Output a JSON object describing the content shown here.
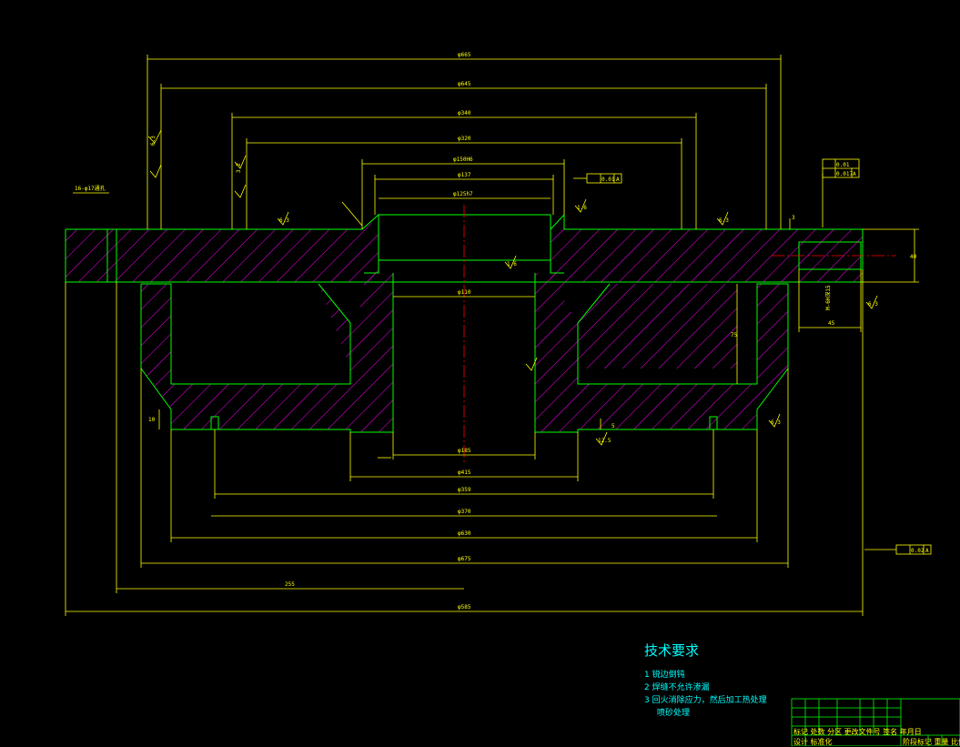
{
  "dims": {
    "d665": "φ665",
    "d645": "φ645",
    "d340": "φ340",
    "d320": "φ320",
    "d150": "φ150H6",
    "d137": "φ137",
    "d125": "φ125h7",
    "d110": "φ110",
    "d185": "φ185",
    "d415": "φ415",
    "d359": "φ359",
    "d370": "φ370",
    "d630": "φ630",
    "d675": "φ675",
    "d585": "φ585",
    "len255": "255",
    "holes": "16-φ17通孔",
    "thread": "M-6H深15",
    "dim45": "45",
    "dim3": "3",
    "dim40": "40",
    "dim75": "75",
    "dim10": "10",
    "dim5": "5"
  },
  "tolerances": {
    "runout1": "0.01",
    "runout2": "0.02",
    "flatness": "0.01",
    "perp": "0.017",
    "datum": "A"
  },
  "roughness": {
    "r1": "6.3",
    "r2": "3.2",
    "r3": "1.6",
    "r4": "12.5"
  },
  "tech": {
    "title": "技术要求",
    "items": [
      {
        "num": "1",
        "text": "锐边倒钝"
      },
      {
        "num": "2",
        "text": "焊缝不允许渗漏"
      },
      {
        "num": "3",
        "text": "回火消除应力，然后加工热处理"
      },
      {
        "num": "",
        "text": "喷砂处理"
      }
    ]
  },
  "titleblock": {
    "row1": "标记 处数 分区 更改文件号 签名 年月日",
    "row2": "设计 标准化",
    "row3": "阶段标记 重量 比例"
  },
  "colors": {
    "outline": "#00ff00",
    "dimension": "#ffff00",
    "hatch": "#ff00ff",
    "centerline": "#ff0000",
    "text": "#00ffff"
  }
}
